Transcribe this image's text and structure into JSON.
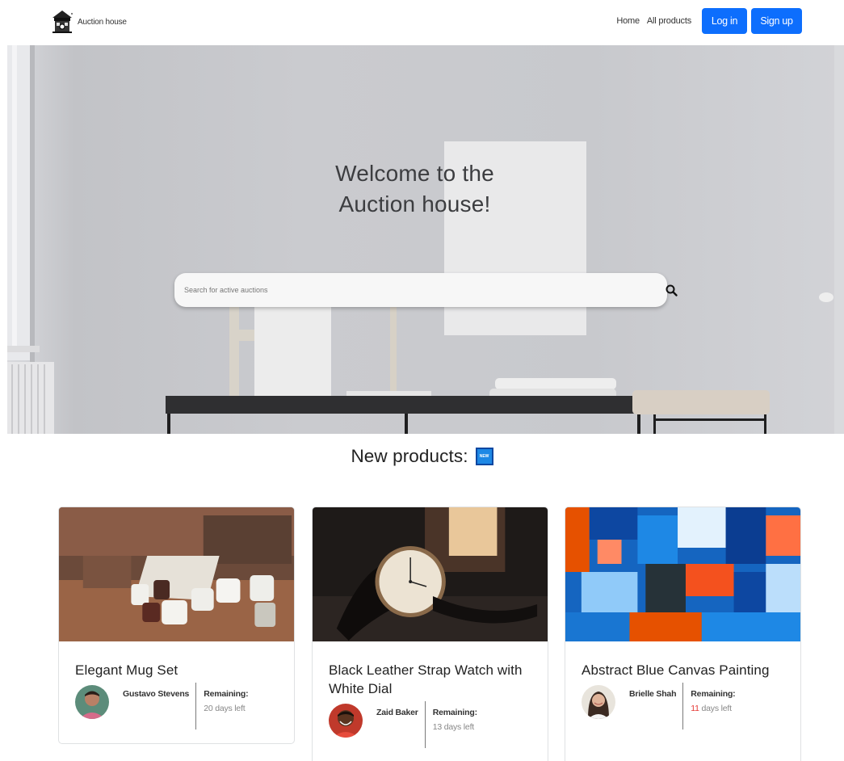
{
  "navbar": {
    "brand_name": "Auction house",
    "links": [
      "Home",
      "All products"
    ],
    "login_label": "Log in",
    "signup_label": "Sign up",
    "brand_icon": "auction-house-logo-icon"
  },
  "hero": {
    "title_line1": "Welcome to the",
    "title_line2": "Auction house!",
    "search_placeholder": "Search for active auctions",
    "search_icon": "search-icon"
  },
  "new_products": {
    "title": "New products:",
    "badge_text": "NEW",
    "cards": [
      {
        "title": "Elegant Mug Set",
        "seller": "Gustavo Stevens",
        "remaining_label": "Remaining:",
        "remaining_days": "20",
        "remaining_suffix": " days left"
      },
      {
        "title": "Black Leather Strap Watch with White Dial",
        "seller": "Zaid Baker",
        "remaining_label": "Remaining:",
        "remaining_days": "13",
        "remaining_suffix": " days left"
      },
      {
        "title": "Abstract Blue Canvas Painting",
        "seller": "Brielle Shah",
        "remaining_label": "Remaining:",
        "remaining_days": "11",
        "remaining_suffix": " days left"
      }
    ]
  },
  "colors": {
    "primary": "#0d6efd",
    "badge_blue": "#1e88e5",
    "urgent_days": "#e53935"
  }
}
